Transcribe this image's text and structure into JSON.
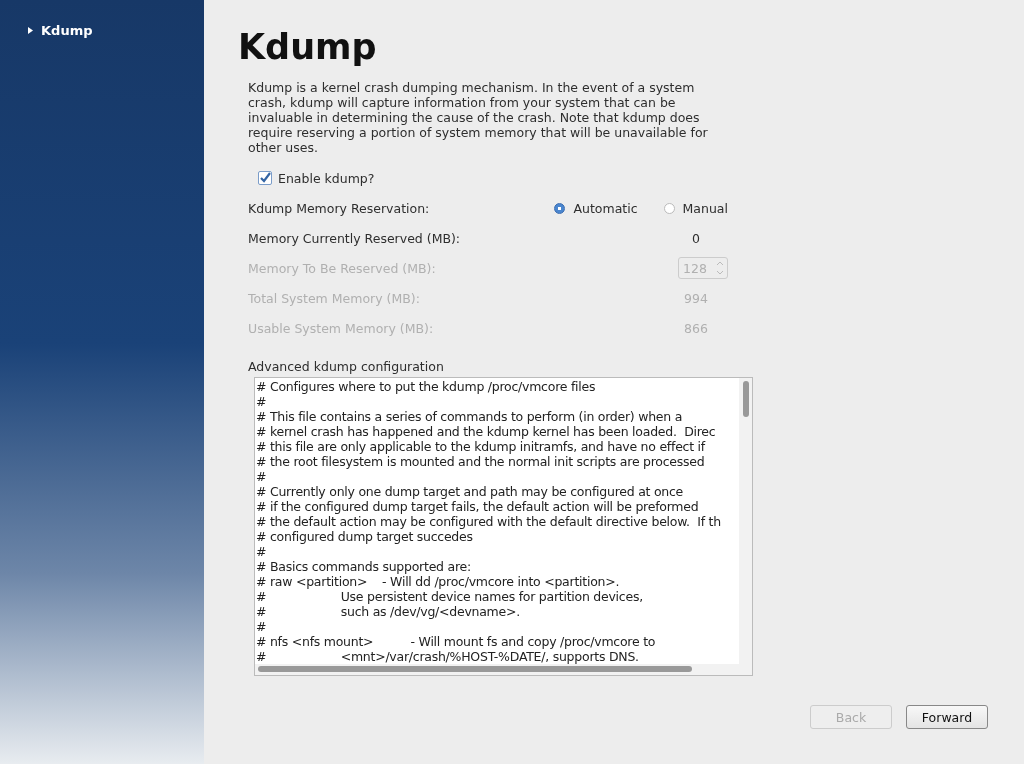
{
  "sidebar": {
    "items": [
      {
        "label": "Kdump",
        "selected": true
      }
    ]
  },
  "page": {
    "title": "Kdump",
    "description": "Kdump is a kernel crash dumping mechanism. In the event of a system crash, kdump will capture information from your system that can be invaluable in determining the cause of the crash. Note that kdump does require reserving a portion of system memory that will be unavailable for other uses."
  },
  "enable_kdump": {
    "label": "Enable kdump?",
    "checked": true
  },
  "reservation": {
    "label": "Kdump Memory Reservation:",
    "options": [
      {
        "label": "Automatic",
        "selected": true
      },
      {
        "label": "Manual",
        "selected": false
      }
    ]
  },
  "memory_rows": [
    {
      "kind": "value",
      "label": "Memory Currently Reserved (MB):",
      "value": "0",
      "disabled": false
    },
    {
      "kind": "spin",
      "label": "Memory To Be Reserved (MB):",
      "value": "128",
      "disabled": true
    },
    {
      "kind": "value",
      "label": "Total System Memory (MB):",
      "value": "994",
      "disabled": true
    },
    {
      "kind": "value",
      "label": "Usable System Memory (MB):",
      "value": "866",
      "disabled": true
    }
  ],
  "advanced": {
    "label": "Advanced kdump configuration",
    "lines": [
      "# Configures where to put the kdump /proc/vmcore files",
      "#",
      "# This file contains a series of commands to perform (in order) when a",
      "# kernel crash has happened and the kdump kernel has been loaded.  Direc",
      "# this file are only applicable to the kdump initramfs, and have no effect if",
      "# the root filesystem is mounted and the normal init scripts are processed",
      "#",
      "# Currently only one dump target and path may be configured at once",
      "# if the configured dump target fails, the default action will be preformed",
      "# the default action may be configured with the default directive below.  If th",
      "# configured dump target succedes",
      "#",
      "# Basics commands supported are:",
      "# raw <partition>    - Will dd /proc/vmcore into <partition>.",
      "#                    Use persistent device names for partition devices,",
      "#                    such as /dev/vg/<devname>.",
      "#",
      "# nfs <nfs mount>          - Will mount fs and copy /proc/vmcore to",
      "#                    <mnt>/var/crash/%HOST-%DATE/, supports DNS."
    ]
  },
  "buttons": [
    {
      "label": "Back",
      "disabled": true
    },
    {
      "label": "Forward",
      "disabled": false
    }
  ]
}
